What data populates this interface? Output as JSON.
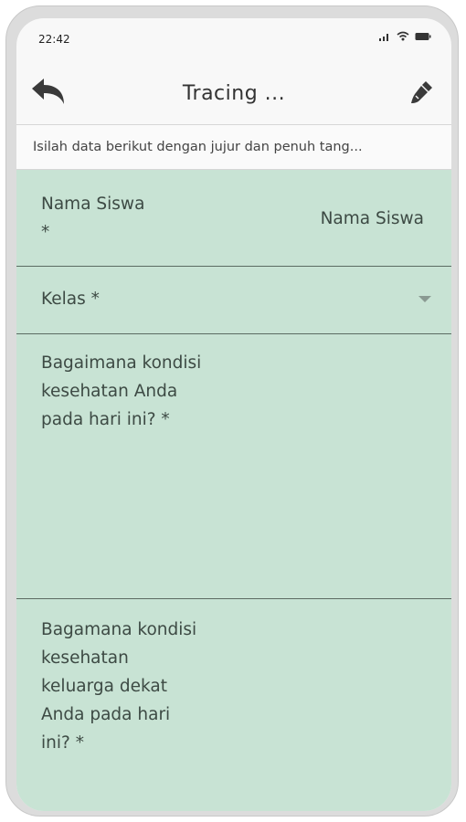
{
  "status_bar": {
    "time": "22:42",
    "icons": [
      "signal-icon",
      "wifi-icon",
      "battery-icon"
    ]
  },
  "app_bar": {
    "title": "Tracing ...",
    "back_icon": "back-arrow-icon",
    "action_icon": "brush-icon"
  },
  "subtitle": "Isilah data berikut dengan jujur dan penuh tang...",
  "form": {
    "nama_siswa": {
      "label_line1": "Nama Siswa",
      "label_line2": "*",
      "value": "Nama Siswa"
    },
    "kelas": {
      "label": "Kelas *"
    },
    "kondisi_kesehatan": {
      "line1": "Bagaimana kondisi",
      "line2": "kesehatan Anda",
      "line3": "pada hari ini? *"
    },
    "kondisi_keluarga": {
      "line1": "Bagamana kondisi",
      "line2": "kesehatan",
      "line3": "keluarga dekat",
      "line4": "Anda pada hari",
      "line5": "ini? *"
    }
  },
  "colors": {
    "form_bg": "#c8e3d4",
    "divider": "#5b6b62",
    "text": "#3d4a44"
  }
}
